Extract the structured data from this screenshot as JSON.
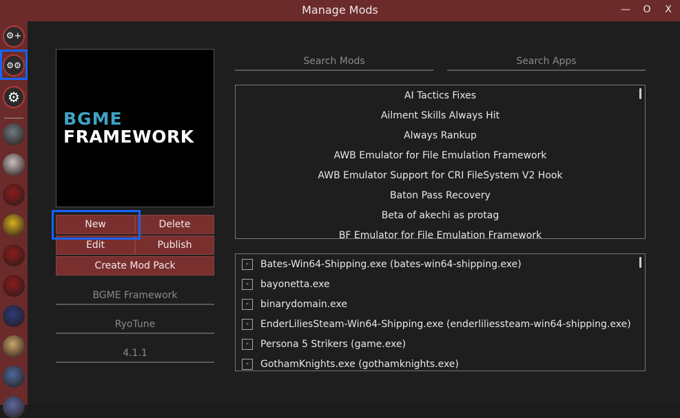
{
  "window": {
    "title": "Manage Mods",
    "minimize": "—",
    "maximize": "O",
    "close": "X"
  },
  "sidebar": {
    "tools": [
      {
        "name": "add-app",
        "icon": "⚙+"
      },
      {
        "name": "manage-mods",
        "icon": "⚙⚙"
      },
      {
        "name": "settings",
        "icon": "⚙"
      }
    ],
    "apps": [
      {
        "name": "app-skull",
        "color": "#6e7a80"
      },
      {
        "name": "app-pale-character",
        "color": "#c8c0c0"
      },
      {
        "name": "app-reloaded-1",
        "color": "#8a1d1d"
      },
      {
        "name": "app-yellow-character",
        "color": "#d4b020"
      },
      {
        "name": "app-reloaded-2",
        "color": "#8a1d1d"
      },
      {
        "name": "app-reloaded-3",
        "color": "#8a1d1d"
      },
      {
        "name": "app-blue-character",
        "color": "#2a3a7a"
      },
      {
        "name": "app-blonde-character",
        "color": "#c8a86a"
      },
      {
        "name": "app-group-character",
        "color": "#4a6a9a"
      },
      {
        "name": "app-partial",
        "color": "#5a6aa0"
      }
    ]
  },
  "preview": {
    "line1": "BGME",
    "line2": "FRAMEWORK"
  },
  "buttons": {
    "new": "New",
    "delete": "Delete",
    "edit": "Edit",
    "publish": "Publish",
    "create_pack": "Create Mod Pack"
  },
  "details": {
    "name": "BGME Framework",
    "author": "RyoTune",
    "version": "4.1.1"
  },
  "search": {
    "mods_placeholder": "Search Mods",
    "apps_placeholder": "Search Apps"
  },
  "mods": [
    "AI Tactics Fixes",
    "Ailment Skills Always Hit",
    "Always Rankup",
    "AWB Emulator for File Emulation Framework",
    "AWB Emulator Support for CRI FileSystem V2 Hook",
    "Baton Pass Recovery",
    "Beta of akechi as protag",
    "BF Emulator for File Emulation Framework"
  ],
  "apps": [
    {
      "label": "Bates-Win64-Shipping.exe (bates-win64-shipping.exe)",
      "check": "-"
    },
    {
      "label": "bayonetta.exe",
      "check": "-"
    },
    {
      "label": "binarydomain.exe",
      "check": "-"
    },
    {
      "label": "EnderLiliesSteam-Win64-Shipping.exe (enderliliessteam-win64-shipping.exe)",
      "check": "-"
    },
    {
      "label": "Persona 5 Strikers (game.exe)",
      "check": "-"
    },
    {
      "label": "GothamKnights.exe (gothamknights.exe)",
      "check": "-"
    }
  ]
}
